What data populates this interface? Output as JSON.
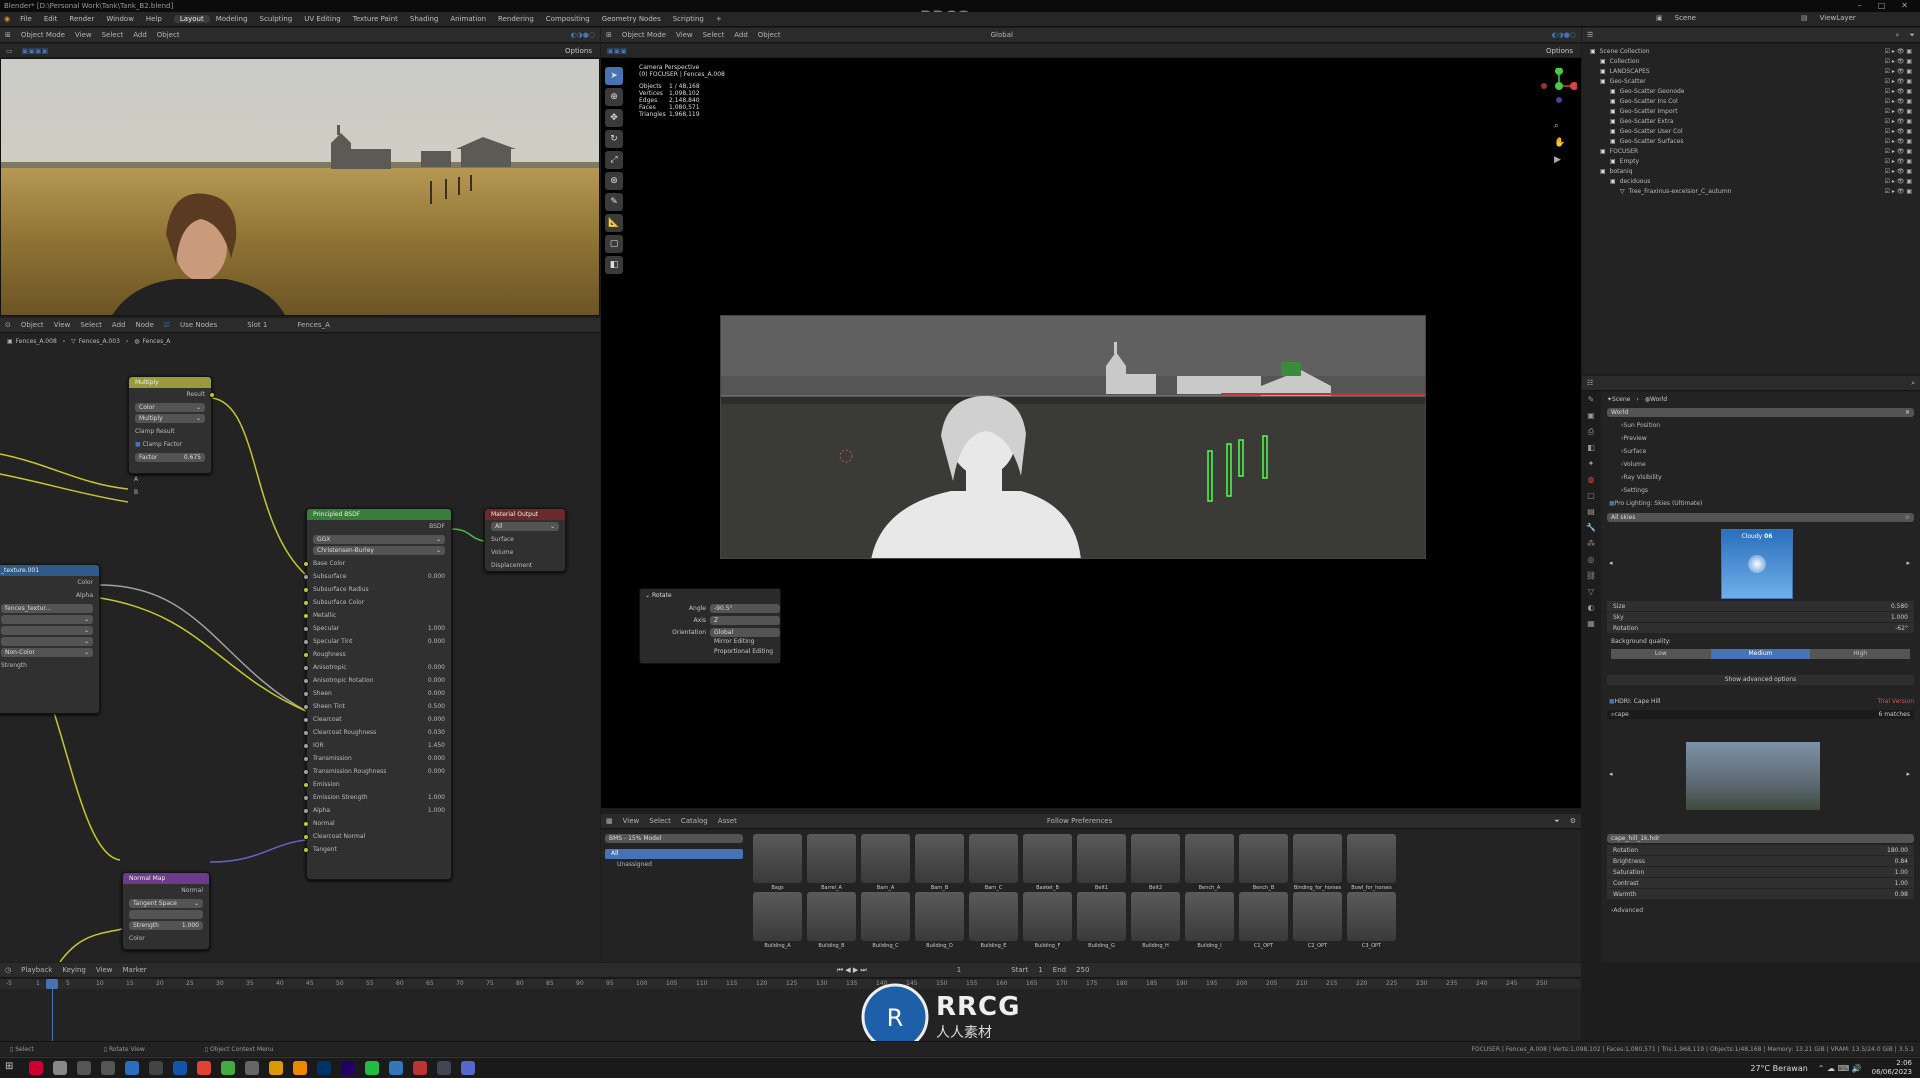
{
  "titlebar": {
    "title": "Blender* [D:\\Personal Work\\Tank\\Tank_B2.blend]",
    "watermark": "RRCG.cn"
  },
  "menu": [
    "File",
    "Edit",
    "Render",
    "Window",
    "Help"
  ],
  "workspaces": [
    "Layout",
    "Modeling",
    "Sculpting",
    "UV Editing",
    "Texture Paint",
    "Shading",
    "Animation",
    "Rendering",
    "Compositing",
    "Geometry Nodes",
    "Scripting"
  ],
  "active_workspace": "Layout",
  "topright": {
    "scene": "Scene",
    "viewlayer": "ViewLayer"
  },
  "left_vp_header": [
    "Object Mode",
    "View",
    "Select",
    "Add",
    "Object"
  ],
  "left_vp_options": "Options",
  "node_header": {
    "items": [
      "Object",
      "View",
      "Select",
      "Add",
      "Node"
    ],
    "use_nodes": "Use Nodes",
    "slot": "Slot 1",
    "material": "Fences_A"
  },
  "breadcrumb": [
    "Fences_A.008",
    "Fences_A.003",
    "Fences_A"
  ],
  "nodes": {
    "multiply": {
      "title": "Multiply",
      "result": "Result",
      "type": "Color",
      "op": "Multiply",
      "clamp_result": "Clamp Result",
      "clamp_factor": "Clamp Factor",
      "factor_label": "Factor",
      "factor": "0.675",
      "a": "A",
      "b": "B"
    },
    "principled": {
      "title": "Principled BSDF",
      "bsdf": "BSDF",
      "dist": "GGX",
      "sss": "Christensen-Burley",
      "rows": [
        [
          "Base Color",
          ""
        ],
        [
          "Subsurface",
          "0.000"
        ],
        [
          "Subsurface Radius",
          ""
        ],
        [
          "Subsurface Color",
          ""
        ],
        [
          "Metallic",
          ""
        ],
        [
          "Specular",
          "1.000"
        ],
        [
          "Specular Tint",
          "0.000"
        ],
        [
          "Roughness",
          ""
        ],
        [
          "Anisotropic",
          "0.000"
        ],
        [
          "Anisotropic Rotation",
          "0.000"
        ],
        [
          "Sheen",
          "0.000"
        ],
        [
          "Sheen Tint",
          "0.500"
        ],
        [
          "Clearcoat",
          "0.000"
        ],
        [
          "Clearcoat Roughness",
          "0.030"
        ],
        [
          "IOR",
          "1.450"
        ],
        [
          "Transmission",
          "0.000"
        ],
        [
          "Transmission Roughness",
          "0.000"
        ],
        [
          "Emission",
          ""
        ],
        [
          "Emission Strength",
          "1.000"
        ],
        [
          "Alpha",
          "1.000"
        ],
        [
          "Normal",
          ""
        ],
        [
          "Clearcoat Normal",
          ""
        ],
        [
          "Tangent",
          ""
        ]
      ]
    },
    "output": {
      "title": "Material Output",
      "target": "All",
      "rows": [
        "Surface",
        "Volume",
        "Displacement"
      ]
    },
    "texture": {
      "title": "_texture.001",
      "color": "Color",
      "alpha": "Alpha",
      "file": "fences_textur...",
      "colorspace": "Non-Color",
      "strength": "Strength"
    },
    "normal": {
      "title": "Normal Map",
      "normal": "Normal",
      "space": "Tangent Space",
      "strength_label": "Strength",
      "strength": "1.000",
      "color": "Color"
    }
  },
  "main_vp": {
    "header": [
      "Object Mode",
      "View",
      "Select",
      "Add",
      "Object"
    ],
    "transform": "Global",
    "options": "Options",
    "camera": "Camera Perspective",
    "collection": "(0) FOCUSER | Fences_A.008",
    "stats": [
      [
        "Objects",
        "1 / 48,168"
      ],
      [
        "Vertices",
        "1,098,102"
      ],
      [
        "Edges",
        "2,148,840"
      ],
      [
        "Faces",
        "1,080,571"
      ],
      [
        "Triangles",
        "1,968,119"
      ]
    ]
  },
  "rotate_op": {
    "title": "Rotate",
    "angle_label": "Angle",
    "angle": "-90.5°",
    "axis_label": "Axis",
    "axis": "Z",
    "orient_label": "Orientation",
    "orient": "Global",
    "mirror": "Mirror Editing",
    "proportional": "Proportional Editing"
  },
  "asset_browser": {
    "header": [
      "View",
      "Select",
      "Catalog",
      "Asset"
    ],
    "follow": "Follow Preferences",
    "library": "BMS - 15% Model",
    "tree": [
      "All",
      "Unassigned"
    ],
    "row1": [
      "Bags",
      "Barrel_A",
      "Barn_A",
      "Barn_B",
      "Barn_C",
      "Basket_B",
      "Belt1",
      "Belt2",
      "Bench_A",
      "Bench_B",
      "Binding_for_horses",
      "Bowl_for_horses"
    ],
    "row2": [
      "Building_A",
      "Building_B",
      "Building_C",
      "Building_D",
      "Building_E",
      "Building_F",
      "Building_G",
      "Building_H",
      "Building_I",
      "C1_OPT",
      "C2_OPT",
      "C3_OPT"
    ]
  },
  "outliner": {
    "items": [
      [
        "Scene Collection",
        0
      ],
      [
        "Collection",
        1
      ],
      [
        "LANDSCAPES",
        1
      ],
      [
        "Geo-Scatter",
        1
      ],
      [
        "Geo-Scatter Geonode",
        2
      ],
      [
        "Geo-Scatter Ins Col",
        2
      ],
      [
        "Geo-Scatter Import",
        2
      ],
      [
        "Geo-Scatter Extra",
        2
      ],
      [
        "Geo-Scatter User Col",
        2
      ],
      [
        "Geo-Scatter Surfaces",
        2
      ],
      [
        "FOCUSER",
        1
      ],
      [
        "Empty",
        2
      ],
      [
        "botaniq",
        1
      ],
      [
        "deciduous",
        2
      ],
      [
        "Tree_Fraxinus-excelsior_C_autumn",
        3
      ]
    ]
  },
  "properties": {
    "crumbs": [
      "Scene",
      "World"
    ],
    "world": "World",
    "sections": [
      "Sun Position",
      "Preview",
      "Surface",
      "Volume",
      "Ray Visibility",
      "Settings"
    ],
    "addon": "Pro Lighting: Skies (Ultimate)",
    "category": "All skies",
    "sky_name": "Cloudy",
    "sky_num": "06",
    "values": [
      [
        "Size",
        "0.580"
      ],
      [
        "Sky",
        "1.000"
      ],
      [
        "Rotation",
        "-62°"
      ]
    ],
    "bg_quality": "Background quality:",
    "quality": [
      "Low",
      "Medium",
      "High"
    ],
    "active_quality": "Medium",
    "advanced": "Show advanced options",
    "hdri": "HDRI: Cape Hill",
    "trial": "Trial Version",
    "search": "cape",
    "matches": "6 matches",
    "hdri_file": "cape_hill_1k.hdr",
    "hdri_values": [
      [
        "Rotation",
        "180.00"
      ],
      [
        "Brightness",
        "0.84"
      ],
      [
        "Saturation",
        "1.00"
      ],
      [
        "Contrast",
        "1.00"
      ],
      [
        "Warmth",
        "0.98"
      ]
    ],
    "adv2": "Advanced"
  },
  "timeline": {
    "menu": [
      "Playback",
      "Keying",
      "View",
      "Marker"
    ],
    "current": "1",
    "start_label": "Start",
    "start": "1",
    "end_label": "End",
    "end": "250",
    "ticks": [
      "-5",
      "1",
      "5",
      "10",
      "15",
      "20",
      "25",
      "30",
      "35",
      "40",
      "45",
      "50",
      "55",
      "60",
      "65",
      "70",
      "75",
      "80",
      "85",
      "90",
      "95",
      "100",
      "105",
      "110",
      "115",
      "120",
      "125",
      "130",
      "135",
      "140",
      "145",
      "150",
      "155",
      "160",
      "165",
      "170",
      "175",
      "180",
      "185",
      "190",
      "195",
      "200",
      "205",
      "210",
      "215",
      "220",
      "225",
      "230",
      "235",
      "240",
      "245",
      "250"
    ]
  },
  "statusbar": {
    "select": "Select",
    "rotate": "Rotate View",
    "context": "Object Context Menu",
    "info": "FOCUSER | Fences_A.008 | Verts:1,098,102 | Faces:1,080,571 | Tris:1,968,119 | Objects:1/48,168 | Memory: 13.21 GiB | VRAM: 13.5/24.0 GiB | 3.5.1"
  },
  "logo": {
    "brand": "RRCG",
    "sub": "人人素材"
  },
  "taskbar": {
    "weather": "27°C Berawan",
    "time": "2:06",
    "date": "06/06/2023"
  },
  "colors": {
    "accent": "#4772b3",
    "node_green": "#3a7d3a",
    "node_yellow": "#9a9a3c",
    "node_purple": "#6c3c8a",
    "node_blue": "#2e5a8a"
  }
}
